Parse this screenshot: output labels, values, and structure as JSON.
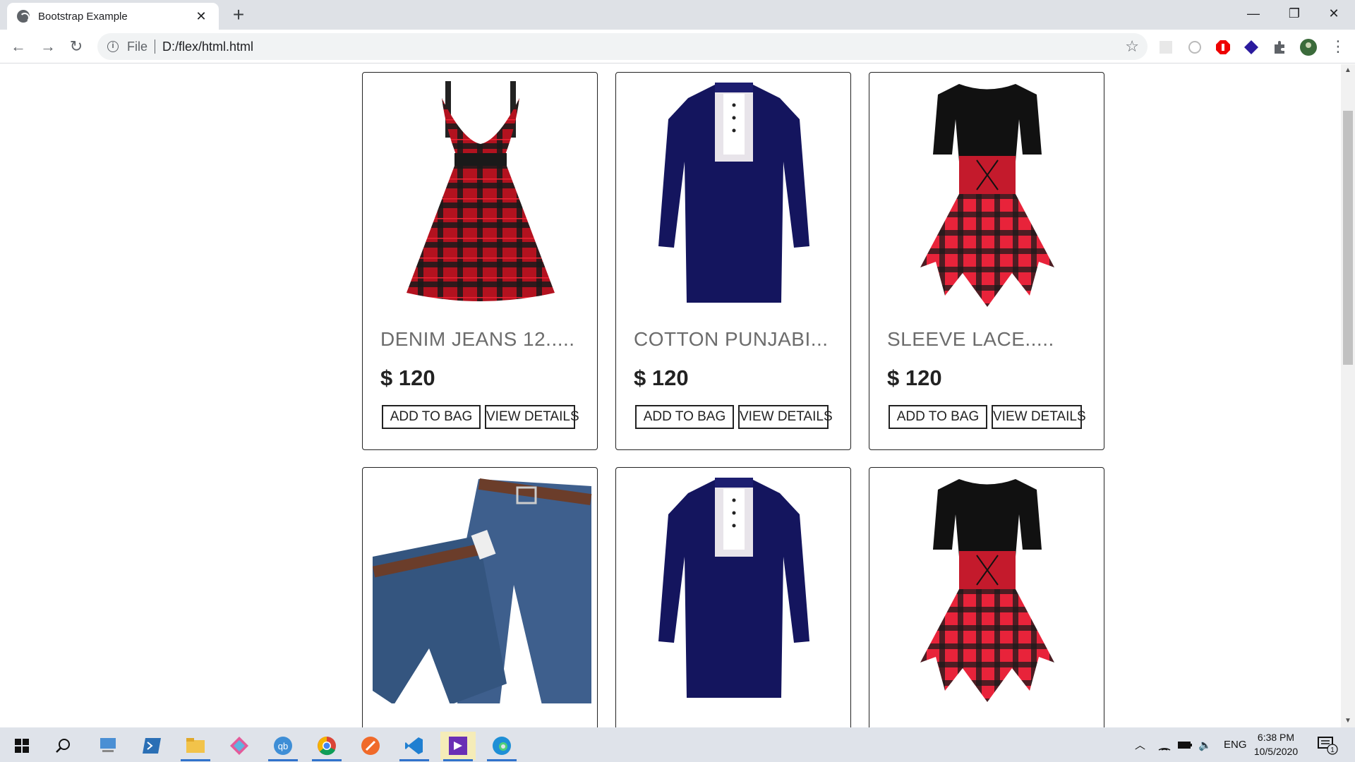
{
  "browser": {
    "tab_title": "Bootstrap Example",
    "tab_close": "✕",
    "new_tab": "+",
    "scheme": "File",
    "url": "D:/flex/html.html",
    "minimize": "—",
    "restore": "❐",
    "close": "✕"
  },
  "products": [
    {
      "name": "DENIM JEANS 12.....",
      "price": "$ 120",
      "add_label": "ADD TO BAG",
      "details_label": "VIEW DETAILS",
      "image": "plaid-dress"
    },
    {
      "name": "COTTON PUNJABI...",
      "price": "$ 120",
      "add_label": "ADD TO BAG",
      "details_label": "VIEW DETAILS",
      "image": "navy-punjabi"
    },
    {
      "name": "SLEEVE LACE.....",
      "price": "$ 120",
      "add_label": "ADD TO BAG",
      "details_label": "VIEW DETAILS",
      "image": "lace-dress"
    },
    {
      "name": "",
      "price": "",
      "add_label": "",
      "details_label": "",
      "image": "denim-jeans"
    },
    {
      "name": "",
      "price": "",
      "add_label": "",
      "details_label": "",
      "image": "navy-punjabi"
    },
    {
      "name": "",
      "price": "",
      "add_label": "",
      "details_label": "",
      "image": "lace-dress"
    }
  ],
  "taskbar": {
    "language": "ENG",
    "time": "6:38 PM",
    "date": "10/5/2020",
    "notification_count": "1"
  },
  "colors": {
    "accent": "#2f72cc",
    "card_border": "#222222",
    "product_name": "#6c6c6c"
  }
}
